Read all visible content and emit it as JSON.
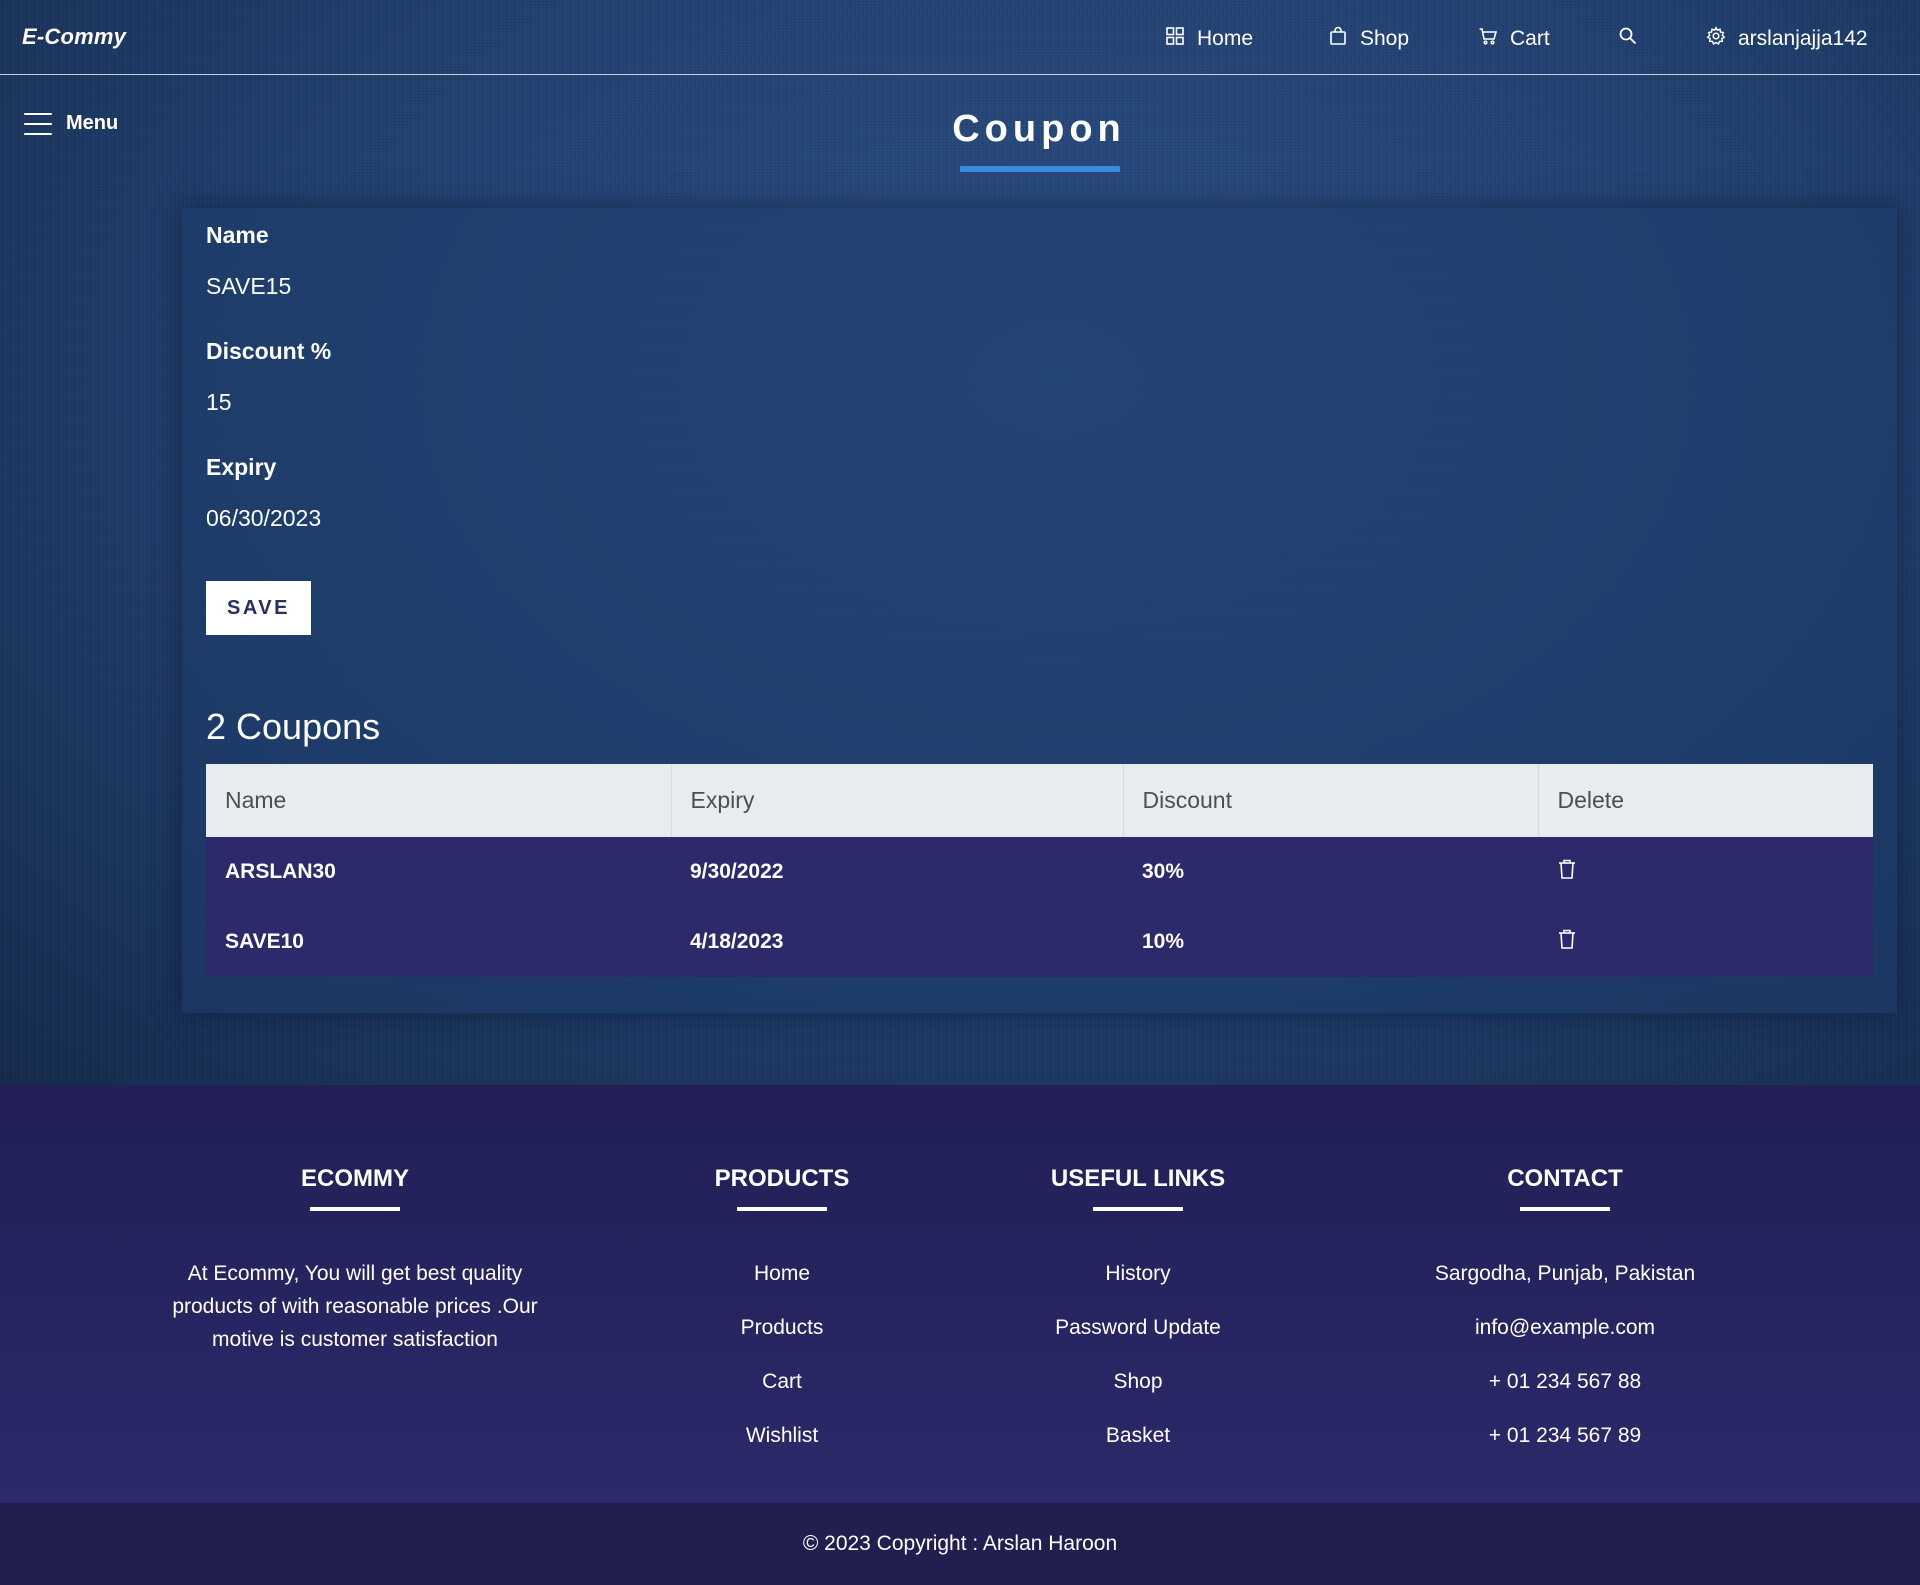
{
  "navbar": {
    "brand": "E-Commy",
    "links": [
      {
        "label": "Home",
        "icon": "grid-icon"
      },
      {
        "label": "Shop",
        "icon": "shopping-bag-icon"
      },
      {
        "label": "Cart",
        "icon": "cart-icon"
      }
    ],
    "search_icon": "search-icon",
    "user": {
      "label": "arslanjajja142",
      "icon": "gear-icon"
    }
  },
  "menu": {
    "label": "Menu"
  },
  "page_title": "Coupon",
  "form": {
    "name_label": "Name",
    "name_value": "SAVE15",
    "discount_label": "Discount %",
    "discount_value": "15",
    "expiry_label": "Expiry",
    "expiry_value": "06/30/2023",
    "save_label": "SAVE"
  },
  "coupons": {
    "heading": "2 Coupons",
    "columns": [
      "Name",
      "Expiry",
      "Discount",
      "Delete"
    ],
    "rows": [
      {
        "name": "ARSLAN30",
        "expiry": "9/30/2022",
        "discount": "30%"
      },
      {
        "name": "SAVE10",
        "expiry": "4/18/2023",
        "discount": "10%"
      }
    ]
  },
  "footer": {
    "about": {
      "heading": "ECOMMY",
      "text": "At Ecommy, You will get best quality products of with reasonable prices .Our motive is customer satisfaction"
    },
    "products": {
      "heading": "PRODUCTS",
      "links": [
        "Home",
        "Products",
        "Cart",
        "Wishlist"
      ]
    },
    "useful_links": {
      "heading": "USEFUL LINKS",
      "links": [
        "History",
        "Password Update",
        "Shop",
        "Basket"
      ]
    },
    "contact": {
      "heading": "CONTACT",
      "items": [
        "Sargodha, Punjab, Pakistan",
        "info@example.com",
        "+ 01 234 567 88",
        "+ 01 234 567 89"
      ]
    },
    "copyright": "© 2023 Copyright : Arslan Haroon"
  },
  "colors": {
    "accent_underline": "#3b8be0",
    "table_row": "#2c2a6b",
    "table_header": "#e9ecef",
    "footer": "#2b2a6a"
  }
}
